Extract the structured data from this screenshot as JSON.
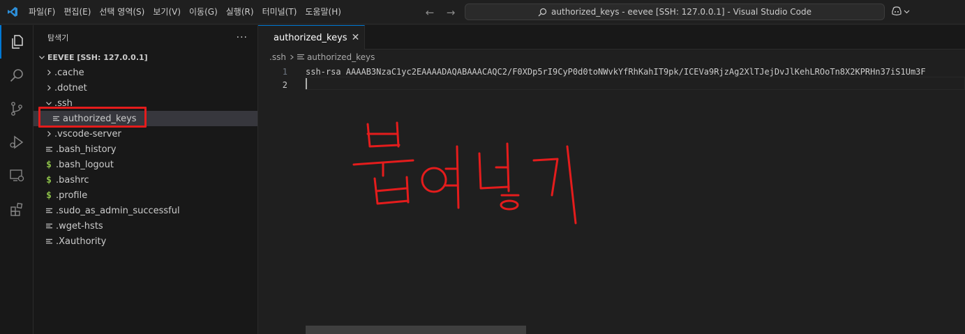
{
  "menubar": {
    "items": [
      "파일(F)",
      "편집(E)",
      "선택 영역(S)",
      "보기(V)",
      "이동(G)",
      "실행(R)",
      "터미널(T)",
      "도움말(H)"
    ]
  },
  "command_center": {
    "text": "authorized_keys - eevee [SSH: 127.0.0.1] - Visual Studio Code"
  },
  "sidebar": {
    "title": "탐색기",
    "section": "EEVEE [SSH: 127.0.0.1]",
    "tree": [
      {
        "label": ".cache",
        "kind": "folder-collapsed",
        "depth": 1
      },
      {
        "label": ".dotnet",
        "kind": "folder-collapsed",
        "depth": 1
      },
      {
        "label": ".ssh",
        "kind": "folder-expanded",
        "depth": 1
      },
      {
        "label": "authorized_keys",
        "kind": "file",
        "depth": 2,
        "selected": true
      },
      {
        "label": ".vscode-server",
        "kind": "folder-collapsed",
        "depth": 1
      },
      {
        "label": ".bash_history",
        "kind": "file",
        "depth": 1
      },
      {
        "label": ".bash_logout",
        "kind": "shell",
        "depth": 1
      },
      {
        "label": ".bashrc",
        "kind": "shell",
        "depth": 1
      },
      {
        "label": ".profile",
        "kind": "shell",
        "depth": 1
      },
      {
        "label": ".sudo_as_admin_successful",
        "kind": "file",
        "depth": 1
      },
      {
        "label": ".wget-hsts",
        "kind": "file",
        "depth": 1
      },
      {
        "label": ".Xauthority",
        "kind": "file",
        "depth": 1
      }
    ]
  },
  "editor": {
    "tab_label": "authorized_keys",
    "breadcrumb": [
      ".ssh",
      "authorized_keys"
    ],
    "lines": [
      {
        "num": "1",
        "text": "ssh-rsa AAAAB3NzaC1yc2EAAAADAQABAAACAQC2/F0XDp5rI9CyP0d0toNWvkYfRhKahIT9pk/ICEVa9RjzAg2XlTJejDvJlKehLROoTn8X2KPRHn37iS1Um3F"
      },
      {
        "num": "2",
        "text": ""
      }
    ]
  },
  "annotation": {
    "text": "붙여넣기",
    "color": "#e41c1c"
  },
  "colors": {
    "accent": "#0078d4",
    "highlight": "#e41c1c",
    "shell_icon": "#8dc149"
  }
}
